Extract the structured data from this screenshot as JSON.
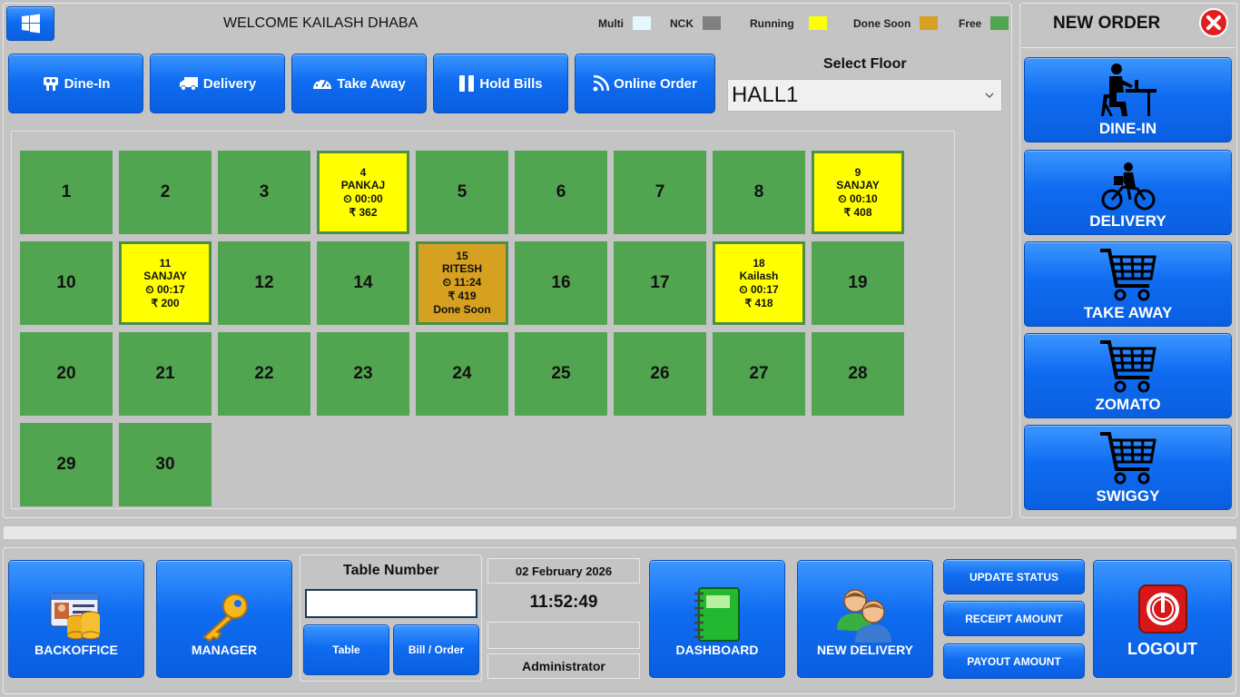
{
  "header": {
    "welcome": "WELCOME KAILASH DHABA",
    "legend": [
      {
        "label": "Multi",
        "color": "#e6f8ff"
      },
      {
        "label": "NCK",
        "color": "#808080"
      },
      {
        "label": "Running",
        "color": "#ffff00"
      },
      {
        "label": "Done Soon",
        "color": "#d6a020"
      },
      {
        "label": "Free",
        "color": "#52a550"
      }
    ]
  },
  "tabs": {
    "dine_in": "Dine-In",
    "delivery": "Delivery",
    "take_away": "Take Away",
    "hold_bills": "Hold Bills",
    "online_order": "Online Order"
  },
  "floor": {
    "label": "Select Floor",
    "selected": "HALL1"
  },
  "tables": {
    "t1": "1",
    "t2": "2",
    "t3": "3",
    "t4": {
      "num": "4",
      "name": "PANKAJ",
      "time": "⏲ 00:00",
      "amount": "₹ 362"
    },
    "t5": "5",
    "t6": "6",
    "t7": "7",
    "t8": "8",
    "t9": {
      "num": "9",
      "name": "SANJAY",
      "time": "⏲ 00:10",
      "amount": "₹ 408"
    },
    "t10": "10",
    "t11": {
      "num": "11",
      "name": "SANJAY",
      "time": "⏲ 00:17",
      "amount": "₹ 200"
    },
    "t12": "12",
    "t14": "14",
    "t15": {
      "num": "15",
      "name": "RITESH",
      "time": "⏲ 11:24",
      "amount": "₹ 419",
      "status": "Done Soon"
    },
    "t16": "16",
    "t17": "17",
    "t18": {
      "num": "18",
      "name": "Kailash",
      "time": "⏲ 00:17",
      "amount": "₹ 418"
    },
    "t19": "19",
    "t20": "20",
    "t21": "21",
    "t22": "22",
    "t23": "23",
    "t24": "24",
    "t25": "25",
    "t26": "26",
    "t27": "27",
    "t28": "28",
    "t29": "29",
    "t30": "30"
  },
  "new_order": {
    "title": "NEW ORDER",
    "dine_in": "DINE-IN",
    "delivery": "DELIVERY",
    "take_away": "TAKE AWAY",
    "zomato": "ZOMATO",
    "swiggy": "SWIGGY"
  },
  "bottom": {
    "backoffice": "BACKOFFICE",
    "manager": "MANAGER",
    "table_number_label": "Table Number",
    "table_number_value": "",
    "table_btn": "Table",
    "bill_btn": "Bill / Order",
    "date": "02 February 2026",
    "time": "11:52:49",
    "blank": "",
    "user": "Administrator",
    "dashboard": "DASHBOARD",
    "new_delivery": "NEW DELIVERY",
    "update_status": "UPDATE STATUS",
    "receipt_amount": "RECEIPT AMOUNT",
    "payout_amount": "PAYOUT AMOUNT",
    "logout": "LOGOUT"
  }
}
